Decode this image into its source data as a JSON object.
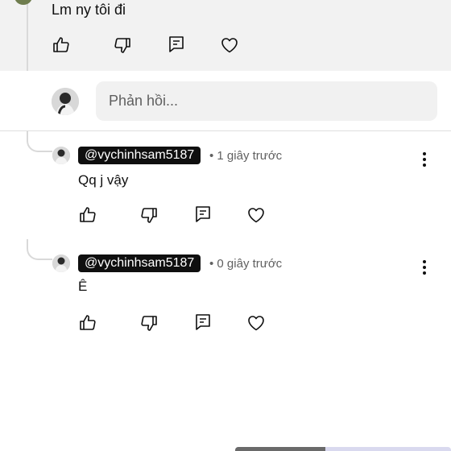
{
  "parent_comment": {
    "text": "Lm ny tôi đi"
  },
  "composer": {
    "placeholder": "Phản hồi..."
  },
  "replies": [
    {
      "handle": "@vychinhsam5187",
      "time": "• 1 giây trước",
      "text": "Qq j vậy"
    },
    {
      "handle": "@vychinhsam5187",
      "time": "• 0 giây trước",
      "text": "Ê"
    }
  ],
  "icons": {
    "like": "thumb-up-icon",
    "dislike": "thumb-down-icon",
    "reply": "comment-icon",
    "heart": "heart-icon",
    "more": "more-vert-icon"
  },
  "colors": {
    "handle_bg": "#0f0f0f",
    "background": "#ffffff",
    "parent_bg": "#f2f2f2"
  }
}
